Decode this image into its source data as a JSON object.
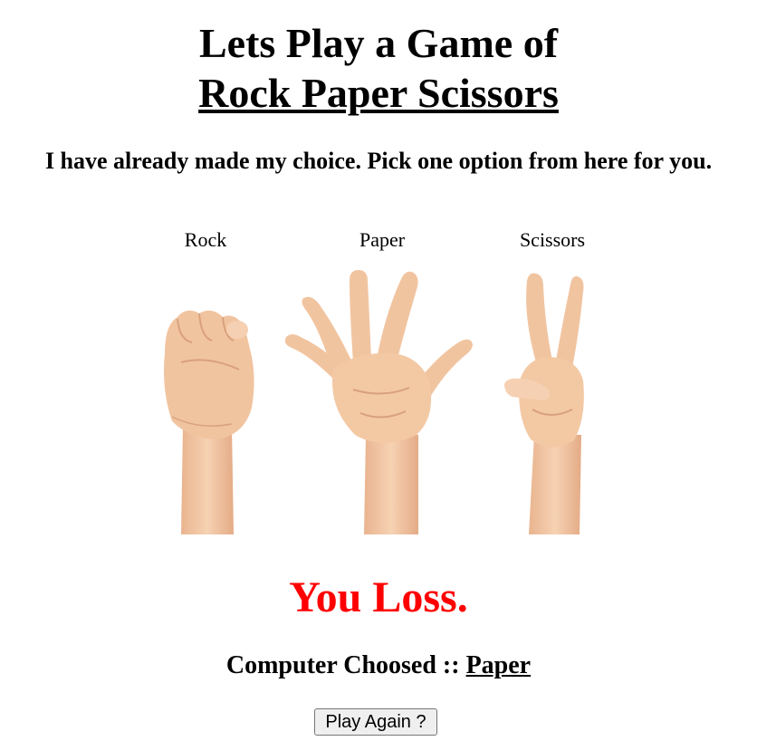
{
  "header": {
    "title_line1": "Lets Play a Game of",
    "title_line2": "Rock Paper Scissors",
    "subtitle": "I have already made my choice. Pick one option from here for you."
  },
  "choices": [
    {
      "label": "Rock",
      "icon": "rock-fist-icon"
    },
    {
      "label": "Paper",
      "icon": "paper-open-hand-icon"
    },
    {
      "label": "Scissors",
      "icon": "scissors-v-sign-icon"
    }
  ],
  "result": {
    "message": "You Loss.",
    "color": "#ff0000",
    "computer_prefix": "Computer Choosed :: ",
    "computer_choice": "Paper"
  },
  "actions": {
    "play_again_label": "Play Again ?"
  },
  "colors": {
    "skin": "#f3c9a4",
    "skin_shadow": "#e3a882"
  }
}
